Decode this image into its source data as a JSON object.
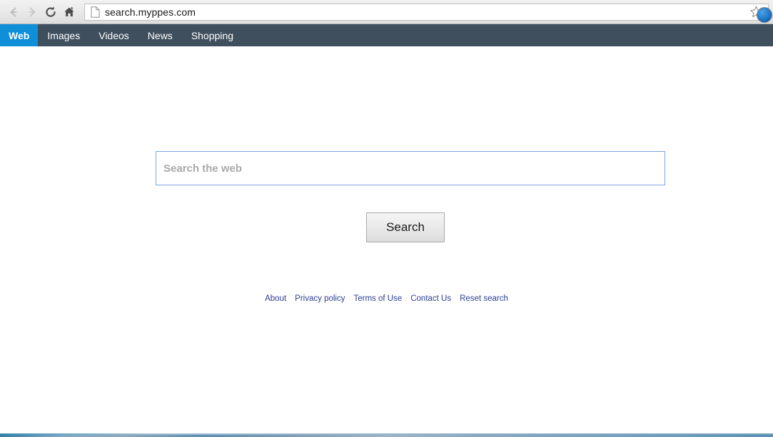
{
  "browser": {
    "back_icon": "back-arrow-icon",
    "forward_icon": "forward-arrow-icon",
    "reload_icon": "reload-icon",
    "home_icon": "home-icon",
    "page_icon": "page-document-icon",
    "url": "search.myppes.com",
    "bookmark_icon": "star-bookmark-icon",
    "extension_icon": "extension-circle-icon"
  },
  "sitenav": {
    "tabs": [
      {
        "label": "Web",
        "active": true
      },
      {
        "label": "Images",
        "active": false
      },
      {
        "label": "Videos",
        "active": false
      },
      {
        "label": "News",
        "active": false
      },
      {
        "label": "Shopping",
        "active": false
      }
    ]
  },
  "search": {
    "value": "",
    "placeholder": "Search the web",
    "button_label": "Search"
  },
  "footer": {
    "links": [
      {
        "label": "About"
      },
      {
        "label": "Privacy policy"
      },
      {
        "label": "Terms of Use"
      },
      {
        "label": "Contact Us"
      },
      {
        "label": "Reset search"
      }
    ]
  },
  "colors": {
    "navbar_bg": "#3f4f5e",
    "active_tab_bg": "#0f8fd8",
    "search_border": "#7da7e2",
    "link_color": "#2b3f93",
    "placeholder_color": "#a9a9a9"
  }
}
